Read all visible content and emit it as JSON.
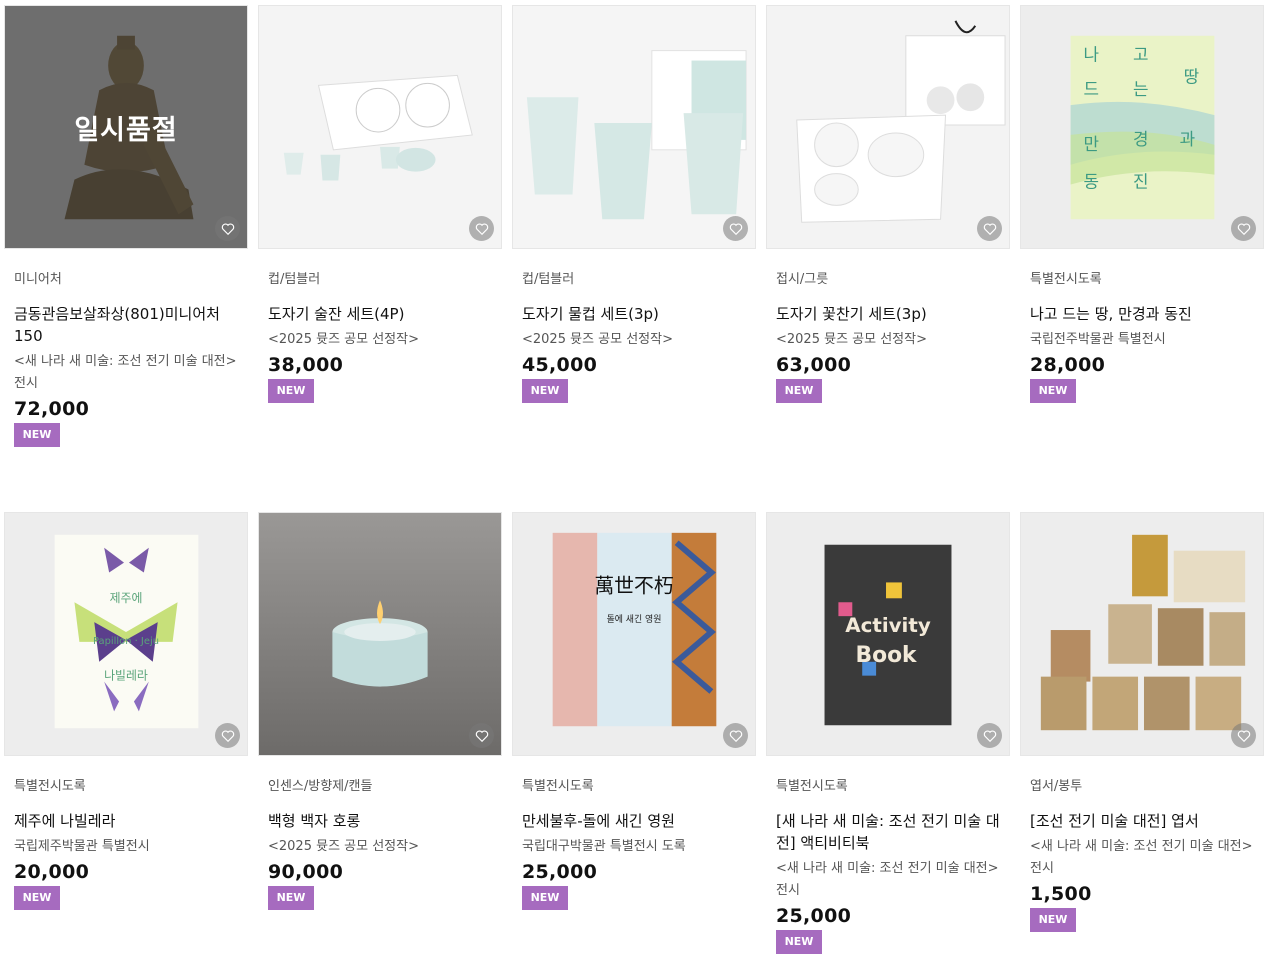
{
  "soldout_label": "일시품절",
  "badge_label": "NEW",
  "colors": {
    "badge": "#a66bbf",
    "soldout_overlay": "#3c3c3c"
  },
  "products": [
    {
      "category": "미니어처",
      "name": "금동관음보살좌상(801)미니어처 150",
      "subtitle": "<새 나라 새 미술: 조선 전기 미술 대전> 전시",
      "price": "72,000",
      "soldout": true,
      "image_icon": "gilt-bodhisattva-statue"
    },
    {
      "category": "컵/텀블러",
      "name": "도자기 술잔 세트(4P)",
      "subtitle": "<2025 뮷즈 공모 선정작>",
      "price": "38,000",
      "image_icon": "porcelain-cups-box"
    },
    {
      "category": "컵/텀블러",
      "name": "도자기 물컵 세트(3p)",
      "subtitle": "<2025 뮷즈 공모 선정작>",
      "price": "45,000",
      "image_icon": "porcelain-tumblers"
    },
    {
      "category": "접시/그릇",
      "name": "도자기 꽃찬기 세트(3p)",
      "subtitle": "<2025 뮷즈 공모 선정작>",
      "price": "63,000",
      "image_icon": "flower-dishes-box"
    },
    {
      "category": "특별전시도록",
      "name": "나고 드는 땅, 만경과 동진",
      "subtitle": "국립전주박물관 특별전시",
      "price": "28,000",
      "image_icon": "catalog-book-green"
    },
    {
      "category": "특별전시도록",
      "name": "제주에 나빌레라",
      "subtitle": "국립제주박물관 특별전시",
      "price": "20,000",
      "image_icon": "butterfly-book"
    },
    {
      "category": "인센스/방향제/캔들",
      "name": "백형 백자 호롱",
      "subtitle": "<2025 뮷즈 공모 선정작>",
      "price": "90,000",
      "image_icon": "porcelain-candle"
    },
    {
      "category": "특별전시도록",
      "name": "만세불후-돌에 새긴 영원",
      "subtitle": "국립대구박물관 특별전시 도록",
      "price": "25,000",
      "image_icon": "calligraphy-book"
    },
    {
      "category": "특별전시도록",
      "name": "[새 나라 새 미술: 조선 전기 미술 대전] 액티비티북",
      "subtitle": "<새 나라 새 미술: 조선 전기 미술 대전> 전시",
      "price": "25,000",
      "image_icon": "activity-book"
    },
    {
      "category": "엽서/봉투",
      "name": "[조선 전기 미술 대전] 엽서",
      "subtitle": "<새 나라 새 미술: 조선 전기 미술 대전> 전시",
      "price": "1,500",
      "image_icon": "postcards-set"
    }
  ],
  "book_covers": {
    "jeonju": {
      "t1": "나",
      "t2": "고",
      "t3": "땅",
      "t4": "드",
      "t5": "는",
      "t6": "만",
      "t7": "경",
      "t8": "과",
      "t9": "동",
      "t10": "진"
    },
    "jeju": {
      "top": "제주에",
      "middle": "Papillon · Jeju",
      "bottom": "나빌레라"
    },
    "daegu": {
      "title": "萬世不朽",
      "sub": "돌에 새긴 영원"
    },
    "activity": {
      "word1": "Activity",
      "word2": "Book"
    }
  }
}
